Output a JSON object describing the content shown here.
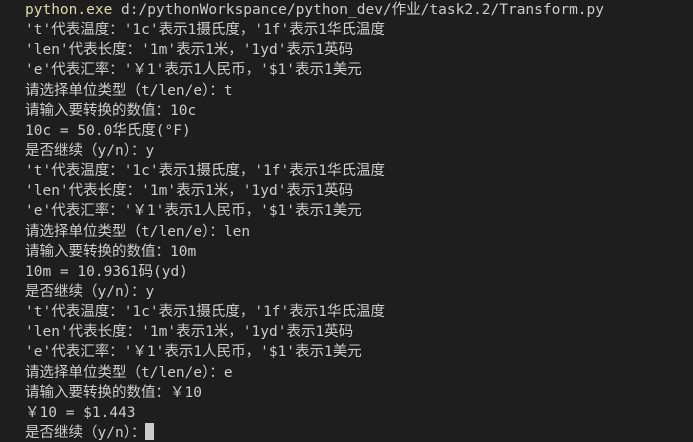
{
  "command": {
    "exe": "python.exe",
    "args": " d:/pythonWorkspance/python_dev/作业/task2.2/Transform.py"
  },
  "lines": [
    "'t'代表温度：'1c'表示1摄氏度，'1f'表示1华氏温度",
    "'len'代表长度：'1m'表示1米，'1yd'表示1英码",
    "'e'代表汇率：'￥1'表示1人民币，'$1'表示1美元",
    "请选择单位类型（t/len/e）：t",
    "请输入要转换的数值：10c",
    "10c = 50.0华氏度(°F)",
    "是否继续（y/n）：y",
    "'t'代表温度：'1c'表示1摄氏度，'1f'表示1华氏温度",
    "'len'代表长度：'1m'表示1米，'1yd'表示1英码",
    "'e'代表汇率：'￥1'表示1人民币，'$1'表示1美元",
    "请选择单位类型（t/len/e）：len",
    "请输入要转换的数值：10m",
    "10m = 10.9361码(yd)",
    "是否继续（y/n）：y",
    "'t'代表温度：'1c'表示1摄氏度，'1f'表示1华氏温度",
    "'len'代表长度：'1m'表示1米，'1yd'表示1英码",
    "'e'代表汇率：'￥1'表示1人民币，'$1'表示1美元",
    "请选择单位类型（t/len/e）：e",
    "请输入要转换的数值：￥10",
    "￥10 = $1.443"
  ],
  "prompt": "是否继续（y/n）："
}
